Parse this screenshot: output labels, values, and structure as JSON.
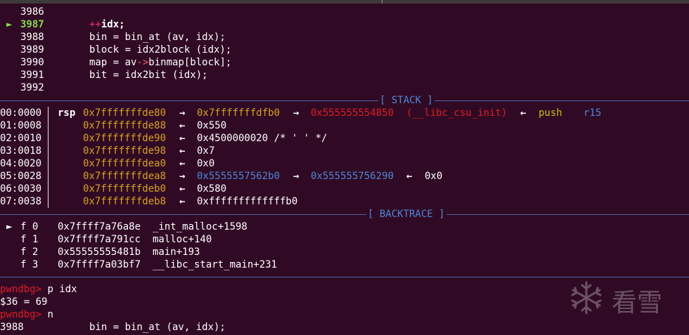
{
  "source": {
    "lines": [
      {
        "num": "3986",
        "code": ""
      },
      {
        "num": "3987",
        "code": "++idx;",
        "current": true
      },
      {
        "num": "3988",
        "code": "bin = bin_at (av, idx);"
      },
      {
        "num": "3989",
        "code": "block = idx2block (idx);"
      },
      {
        "num": "3990",
        "code": "map = av->binmap[block];"
      },
      {
        "num": "3991",
        "code": "bit = idx2bit (idx);"
      },
      {
        "num": "3992",
        "code": ""
      }
    ],
    "current_marker": "►"
  },
  "stack": {
    "label": "[ STACK ]",
    "rows": [
      {
        "idx": "00:0000",
        "reg": "rsp",
        "addr": "0x7fffffffde80",
        "a1": "→",
        "v1": "0x7fffffffdfb0",
        "a2": "→",
        "v2": "0x555555554850",
        "v2note": "(__libc_csu_init)",
        "a3": "←",
        "v3": "push",
        "v4": "r15"
      },
      {
        "idx": "01:0008",
        "addr": "0x7fffffffde88",
        "a1": "←",
        "v1": "0x550"
      },
      {
        "idx": "02:0010",
        "addr": "0x7fffffffde90",
        "a1": "←",
        "v1": "0x4500000020 /* ' ' */"
      },
      {
        "idx": "03:0018",
        "addr": "0x7fffffffde98",
        "a1": "←",
        "v1": "0x7"
      },
      {
        "idx": "04:0020",
        "addr": "0x7fffffffdea0",
        "a1": "←",
        "v1": "0x0"
      },
      {
        "idx": "05:0028",
        "addr": "0x7fffffffdea8",
        "a1": "→",
        "v1": "0x5555557562b0",
        "a2": "→",
        "v2": "0x555555756290",
        "a3": "←",
        "v3": "0x0"
      },
      {
        "idx": "06:0030",
        "addr": "0x7fffffffdeb0",
        "a1": "←",
        "v1": "0x580"
      },
      {
        "idx": "07:0038",
        "addr": "0x7fffffffdeb8",
        "a1": "←",
        "v1": "0xfffffffffffffb0"
      }
    ]
  },
  "backtrace": {
    "label": "[ BACKTRACE ]",
    "marker": "►",
    "frames": [
      {
        "frame": "f 0",
        "addr": "0x7ffff7a76a8e",
        "sym": "_int_malloc+1598"
      },
      {
        "frame": "f 1",
        "addr": "0x7ffff7a791cc",
        "sym": "malloc+140"
      },
      {
        "frame": "f 2",
        "addr": "0x55555555481b",
        "sym": "main+193"
      },
      {
        "frame": "f 3",
        "addr": "0x7ffff7a03bf7",
        "sym": "__libc_start_main+231"
      }
    ]
  },
  "console": {
    "prompt": "pwndbg>",
    "lines": [
      {
        "type": "cmd",
        "text": " p idx"
      },
      {
        "type": "out",
        "text": "$36 = 69"
      },
      {
        "type": "cmd",
        "text": " n"
      },
      {
        "type": "src",
        "num": "3988",
        "code": "bin = bin_at (av, idx);"
      }
    ]
  },
  "watermark": {
    "icon": "snowflake-icon",
    "text": "看雪"
  },
  "colors": {
    "background": "#300a24",
    "prompt": "#e01b24",
    "address": "#d7a31a",
    "separator": "#4c62a8"
  }
}
